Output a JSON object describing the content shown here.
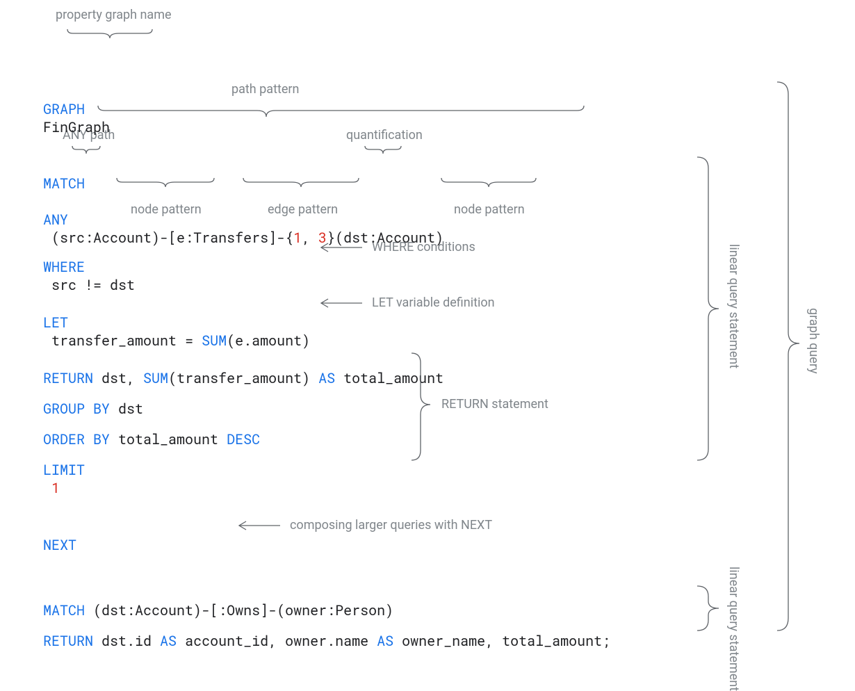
{
  "annotations": {
    "property_graph_name": "property graph name",
    "path_pattern": "path pattern",
    "any_path": "ANY path",
    "quantification": "quantification",
    "node_pattern_left": "node pattern",
    "edge_pattern": "edge pattern",
    "node_pattern_right": "node pattern",
    "where_conditions": "WHERE conditions",
    "let_variable_definition": "LET variable definition",
    "return_statement": "RETURN statement",
    "composing_next": "composing larger queries with NEXT",
    "linear_query_statement_1": "linear query statement",
    "linear_query_statement_2": "linear query statement",
    "graph_query": "graph query"
  },
  "code": {
    "line1": {
      "kw_graph": "GRAPH",
      "graph_name": "FinGraph"
    },
    "line2": {
      "kw_match": "MATCH",
      "kw_any": "ANY",
      "open1": "(src:Account)-[e:Transfers]-{",
      "num1": "1",
      "comma": ", ",
      "num2": "3",
      "close": "}(dst:Account)"
    },
    "line3": {
      "kw_where": "WHERE",
      "cond": "src != dst"
    },
    "line4": {
      "kw_let": "LET",
      "lhs": "transfer_amount = ",
      "fn_sum": "SUM",
      "rhs": "(e.amount)"
    },
    "line5": {
      "kw_return": "RETURN",
      "a": " dst, ",
      "fn_sum": "SUM",
      "b": "(transfer_amount) ",
      "kw_as": "AS",
      "c": " total_amount"
    },
    "line6": {
      "kw_group_by": "GROUP BY",
      "a": " dst"
    },
    "line7": {
      "kw_order_by": "ORDER BY",
      "a": " total_amount ",
      "kw_desc": "DESC"
    },
    "line8": {
      "kw_limit": "LIMIT",
      "num": "1"
    },
    "line9": {
      "kw_next": "NEXT"
    },
    "line10": {
      "kw_match": "MATCH",
      "a": " (dst:Account)-[:Owns]-(owner:Person)"
    },
    "line11": {
      "kw_return": "RETURN",
      "a": " dst.id ",
      "kw_as1": "AS",
      "b": " account_id, owner.name ",
      "kw_as2": "AS",
      "c": " owner_name, total_amount;"
    }
  }
}
